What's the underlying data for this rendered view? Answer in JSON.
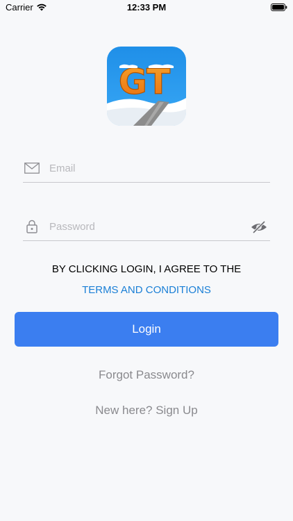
{
  "status_bar": {
    "carrier": "Carrier",
    "time": "12:33 PM",
    "wifi_icon": "wifi-icon",
    "battery_icon": "battery-full-icon"
  },
  "logo": {
    "text": "GT",
    "colors": {
      "sky": "#1f8fe8",
      "letters": "#f28a1a",
      "snow": "#ffffff",
      "road": "#8c8c8c"
    }
  },
  "form": {
    "email": {
      "icon": "mail-icon",
      "placeholder": "Email",
      "value": ""
    },
    "password": {
      "icon": "lock-icon",
      "placeholder": "Password",
      "value": "",
      "toggle_icon": "eye-slash-icon"
    }
  },
  "terms": {
    "agree_text": "BY CLICKING LOGIN, I AGREE TO THE",
    "link_text": "TERMS AND CONDITIONS",
    "link_color": "#1a7fd6"
  },
  "actions": {
    "login_label": "Login",
    "login_color": "#3b7ef0",
    "forgot_label": "Forgot Password?",
    "signup_label": "New here? Sign Up"
  }
}
